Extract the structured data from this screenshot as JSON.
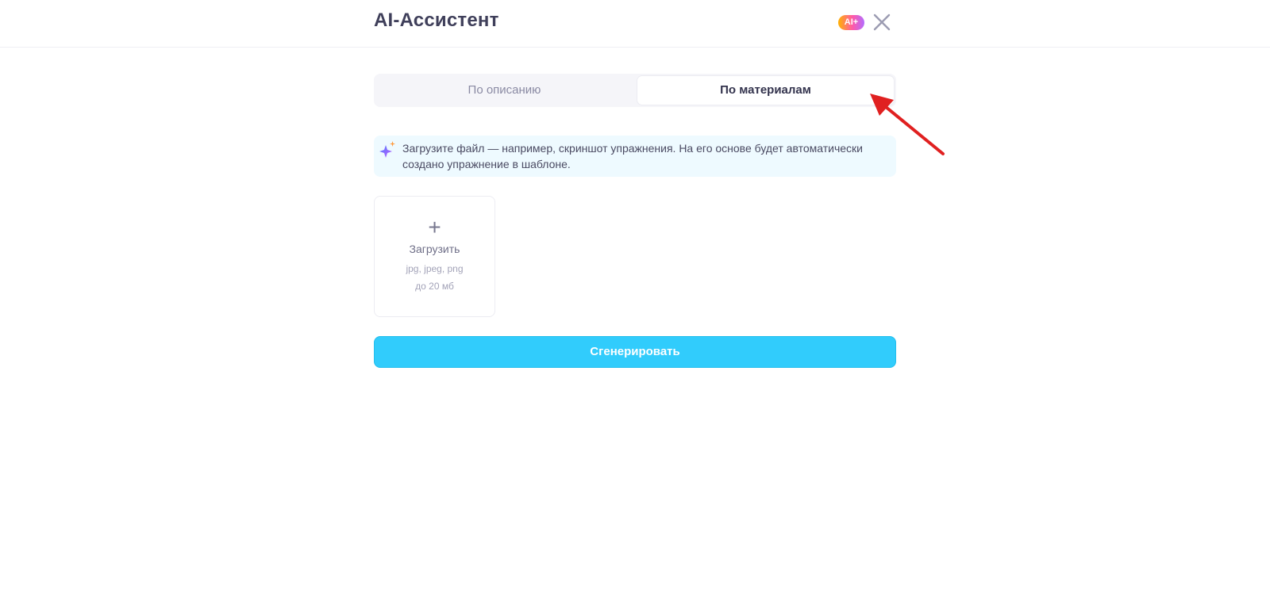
{
  "header": {
    "title": "AI-Ассистент",
    "badge": "AI+",
    "close_icon": "close-icon"
  },
  "tabs": [
    {
      "label": "По описанию",
      "active": false
    },
    {
      "label": "По материалам",
      "active": true
    }
  ],
  "info": {
    "icon": "sparkle-icon",
    "text": "Загрузите файл — например, скриншот упражнения. На его основе будет автоматически создано упражнение в шаблоне."
  },
  "upload": {
    "icon": "plus-icon",
    "label": "Загрузить",
    "formats": "jpg, jpeg, png",
    "max_size": "до 20 мб"
  },
  "generate": {
    "label": "Сгенерировать"
  },
  "annotation": {
    "icon": "red-arrow-icon",
    "color": "#e02020"
  },
  "colors": {
    "accent": "#31ccfc",
    "info_bg": "#eefaff",
    "tabs_bg": "#f5f5f9"
  }
}
